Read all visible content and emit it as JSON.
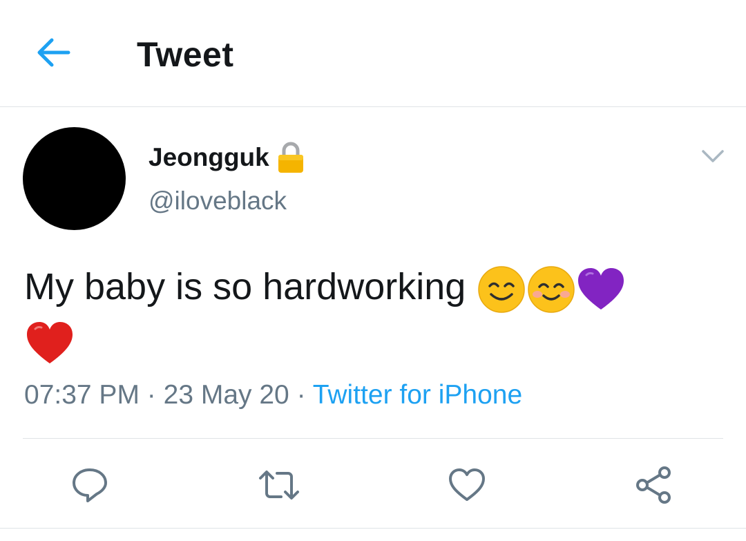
{
  "header": {
    "title": "Tweet",
    "back_icon": "arrow-left-icon",
    "accent": "#1da1f2"
  },
  "tweet": {
    "display_name": "Jeongguk",
    "protected_icon": "lock-icon",
    "handle": "@iloveblack",
    "text": "My baby is so hardworking",
    "emojis": [
      "smiling-face-icon",
      "smiling-face-icon",
      "purple-heart-icon",
      "red-heart-icon"
    ],
    "time": "07:37 PM",
    "date": "23 May 20",
    "source": "Twitter for iPhone",
    "separator": "·"
  },
  "actions": [
    "reply-icon",
    "retweet-icon",
    "like-icon",
    "share-icon"
  ],
  "colors": {
    "secondary_text": "#657786",
    "divider": "#dfe3e6",
    "link": "#1da1f2",
    "icon": "#657786"
  }
}
